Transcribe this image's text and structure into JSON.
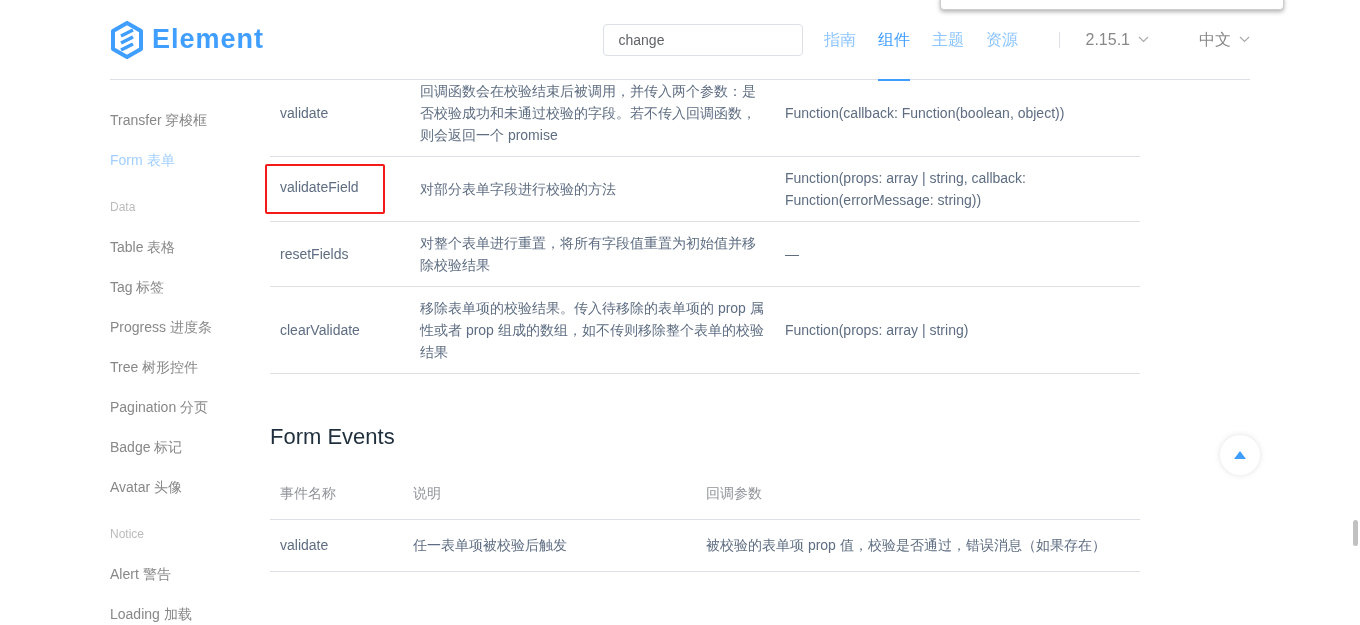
{
  "header": {
    "logo_text": "Element",
    "search": {
      "value": "change"
    },
    "nav": [
      {
        "label": "指南",
        "selected": false
      },
      {
        "label": "组件",
        "selected": true
      },
      {
        "label": "主题",
        "selected": false
      },
      {
        "label": "资源",
        "selected": false
      }
    ],
    "version": {
      "label": "2.15.1"
    },
    "language": {
      "label": "中文"
    }
  },
  "sidebar": {
    "groups": [
      {
        "items": [
          {
            "label": "Transfer 穿梭框",
            "selected": false
          },
          {
            "label": "Form 表单",
            "selected": true
          }
        ]
      },
      {
        "title": "Data",
        "items": [
          {
            "label": "Table 表格",
            "selected": false
          },
          {
            "label": "Tag 标签",
            "selected": false
          },
          {
            "label": "Progress 进度条",
            "selected": false
          },
          {
            "label": "Tree 树形控件",
            "selected": false
          },
          {
            "label": "Pagination 分页",
            "selected": false
          },
          {
            "label": "Badge 标记",
            "selected": false
          },
          {
            "label": "Avatar 头像",
            "selected": false
          }
        ]
      },
      {
        "title": "Notice",
        "items": [
          {
            "label": "Alert 警告",
            "selected": false
          },
          {
            "label": "Loading 加载",
            "selected": false
          }
        ]
      }
    ]
  },
  "methods_table": {
    "rows": [
      {
        "name": "validate",
        "description": "回调函数会在校验结束后被调用，并传入两个参数：是否校验成功和未通过校验的字段。若不传入回调函数，则会返回一个 promise",
        "params": "Function(callback: Function(boolean, object))",
        "highlighted": false
      },
      {
        "name": "validateField",
        "description": "对部分表单字段进行校验的方法",
        "params": "Function(props: array | string, callback: Function(errorMessage: string))",
        "highlighted": true
      },
      {
        "name": "resetFields",
        "description": "对整个表单进行重置，将所有字段值重置为初始值并移除校验结果",
        "params": "—",
        "highlighted": false
      },
      {
        "name": "clearValidate",
        "description": "移除表单项的校验结果。传入待移除的表单项的 prop 属性或者 prop 组成的数组，如不传则移除整个表单的校验结果",
        "params": "Function(props: array | string)",
        "highlighted": false
      }
    ]
  },
  "events": {
    "title": "Form Events",
    "table": {
      "columns": [
        "事件名称",
        "说明",
        "回调参数"
      ],
      "rows": [
        [
          "validate",
          "任一表单项被校验后触发",
          "被校验的表单项 prop 值，校验是否通过，错误消息（如果存在）"
        ]
      ]
    }
  }
}
